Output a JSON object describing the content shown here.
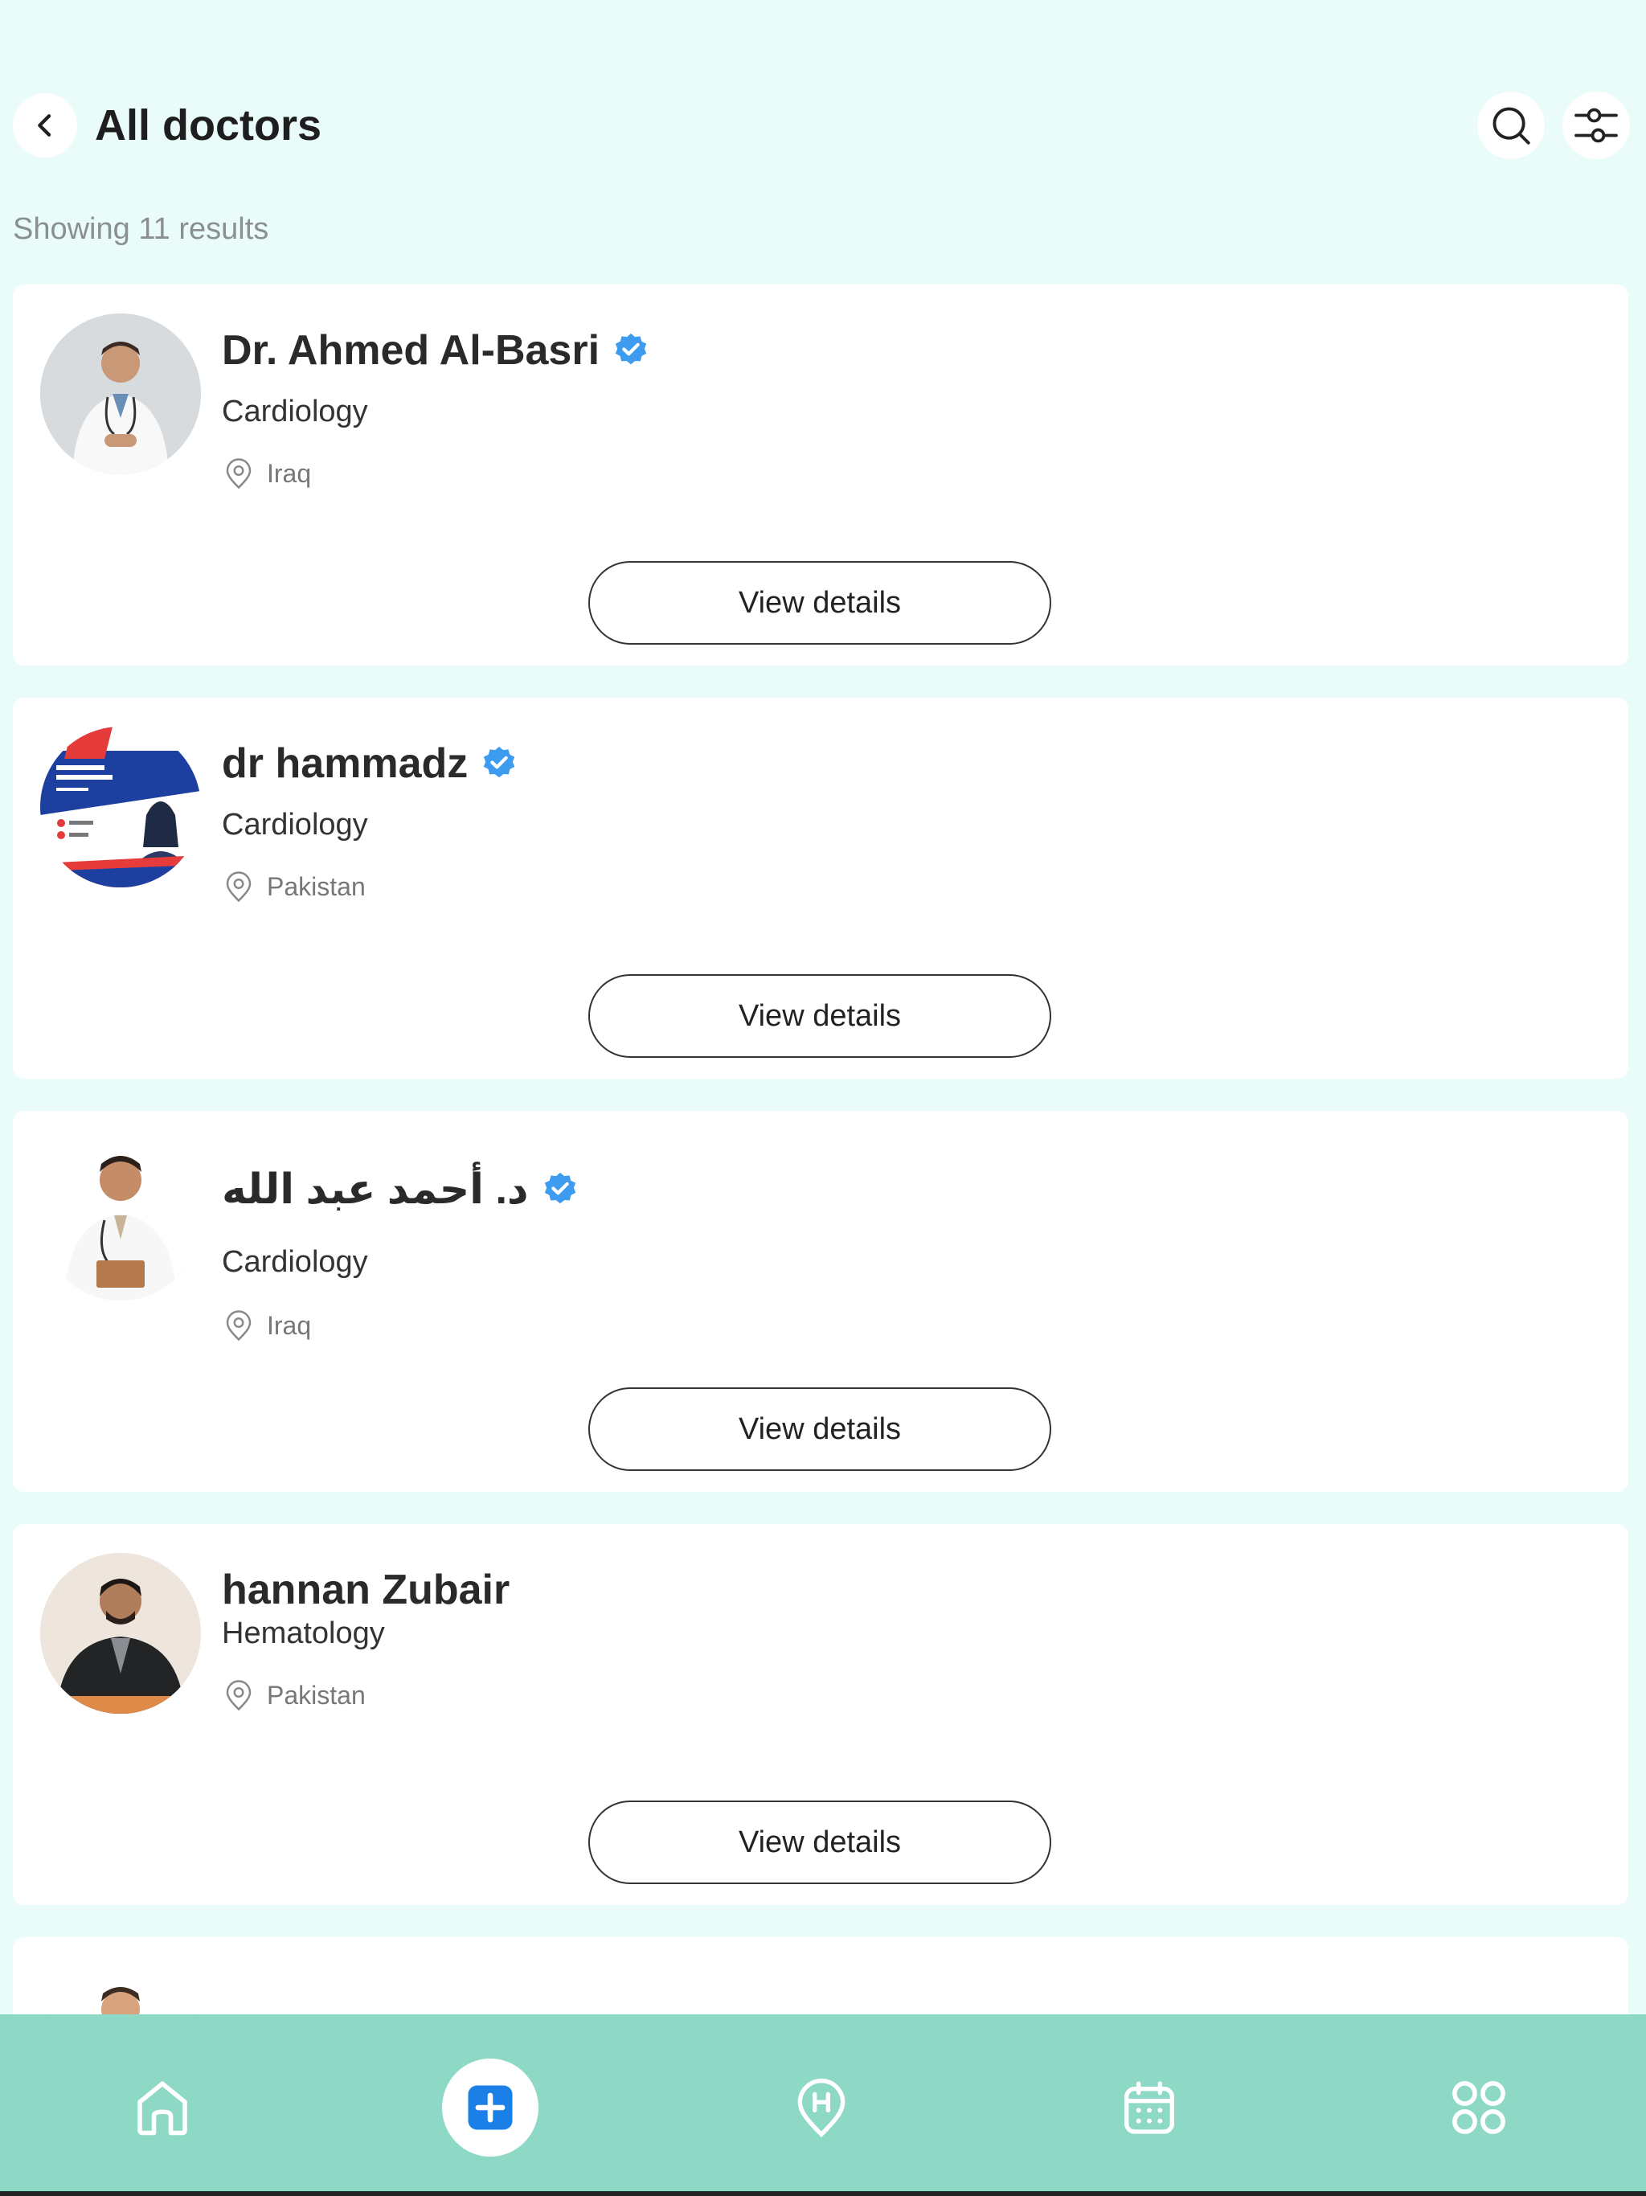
{
  "header": {
    "title": "All doctors"
  },
  "results": {
    "text": "Showing 11 results"
  },
  "doctors": [
    {
      "name": "Dr. Ahmed Al-Basri",
      "verified": true,
      "specialty": "Cardiology",
      "location": "Iraq",
      "button": "View details"
    },
    {
      "name": "dr hammadz",
      "verified": true,
      "specialty": "Cardiology",
      "location": "Pakistan",
      "button": "View details"
    },
    {
      "name": "د. أحمد عبد الله",
      "verified": true,
      "specialty": "Cardiology",
      "location": "Iraq",
      "button": "View details"
    },
    {
      "name": "hannan Zubair",
      "verified": false,
      "specialty": "Hematology",
      "location": "Pakistan",
      "button": "View details"
    }
  ],
  "nav": {
    "items": [
      "home-icon",
      "add-appointment-icon",
      "hospital-location-icon",
      "calendar-icon",
      "more-apps-icon"
    ]
  },
  "colors": {
    "background": "#E9FCFA",
    "nav_background": "#8ED8C6",
    "verified": "#3D9BF0",
    "add_button": "#1A7FE6"
  }
}
